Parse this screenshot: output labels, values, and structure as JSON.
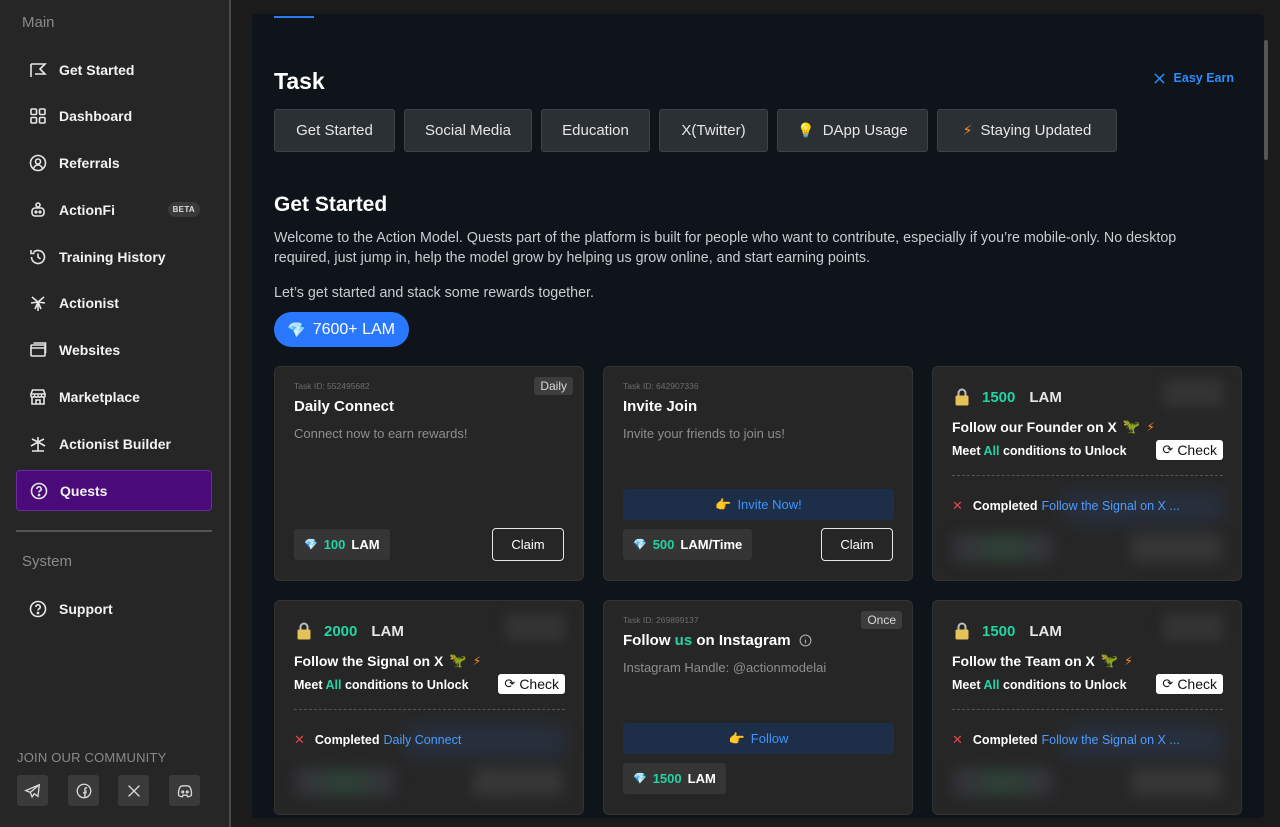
{
  "sidebar": {
    "main_label": "Main",
    "system_label": "System",
    "community_label": "JOIN OUR COMMUNITY",
    "items": [
      {
        "label": "Get Started"
      },
      {
        "label": "Dashboard"
      },
      {
        "label": "Referrals"
      },
      {
        "label": "ActionFi",
        "badge": "BETA"
      },
      {
        "label": "Training History"
      },
      {
        "label": "Actionist"
      },
      {
        "label": "Websites"
      },
      {
        "label": "Marketplace"
      },
      {
        "label": "Actionist Builder"
      },
      {
        "label": "Quests",
        "active": true
      }
    ],
    "support_label": "Support"
  },
  "header": {
    "title": "Task",
    "easy_earn": "Easy Earn"
  },
  "tabs": [
    "Get Started",
    "Social Media",
    "Education",
    "X(Twitter)",
    "DApp Usage",
    "Staying Updated"
  ],
  "section": {
    "title": "Get Started",
    "description": "Welcome to the Action Model. Quests part of the platform is built for people who want to contribute, especially if you’re mobile-only. No desktop required, just jump in, help the model grow by helping us grow online, and start earning points.",
    "tagline": "Let’s get started and stack some rewards together.",
    "total_reward": "7600+ LAM"
  },
  "cards": {
    "daily_connect": {
      "task_id": "Task ID: 552495682",
      "badge": "Daily",
      "title": "Daily Connect",
      "subtitle": "Connect now to earn rewards!",
      "reward_amount": "100",
      "reward_unit": "LAM",
      "button": "Claim"
    },
    "invite_join": {
      "task_id": "Task ID: 642907336",
      "title": "Invite Join",
      "subtitle": "Invite your friends to join us!",
      "action": "Invite Now!",
      "reward_amount": "500",
      "reward_unit": "LAM/Time",
      "button": "Claim"
    },
    "follow_founder": {
      "amount": "1500",
      "unit": "LAM",
      "title": "Follow our Founder on X",
      "meet_prefix": "Meet",
      "meet_all": "All",
      "meet_suffix": "conditions to Unlock",
      "check": "Check",
      "completed_label": "Completed",
      "completed_link": "Follow the Signal on X ..."
    },
    "follow_signal": {
      "amount": "2000",
      "unit": "LAM",
      "title": "Follow the Signal on X",
      "meet_prefix": "Meet",
      "meet_all": "All",
      "meet_suffix": "conditions to Unlock",
      "check": "Check",
      "completed_label": "Completed",
      "completed_link": "Daily Connect"
    },
    "instagram": {
      "task_id": "Task ID: 269899137",
      "badge": "Once",
      "title_pre": "Follow",
      "title_us": "us",
      "title_post": "on Instagram",
      "subtitle": "Instagram Handle: @actionmodelai",
      "action": "Follow",
      "reward_amount": "1500",
      "reward_unit": "LAM"
    },
    "follow_team": {
      "amount": "1500",
      "unit": "LAM",
      "title": "Follow the Team on X",
      "meet_prefix": "Meet",
      "meet_all": "All",
      "meet_suffix": "conditions to Unlock",
      "check": "Check",
      "completed_label": "Completed",
      "completed_link": "Follow the Signal on X ..."
    }
  },
  "colors": {
    "accent_blue": "#2a78ff",
    "reward_green": "#23d4a3",
    "active_purple": "#4b0a7a",
    "link_blue": "#4d9cff"
  }
}
